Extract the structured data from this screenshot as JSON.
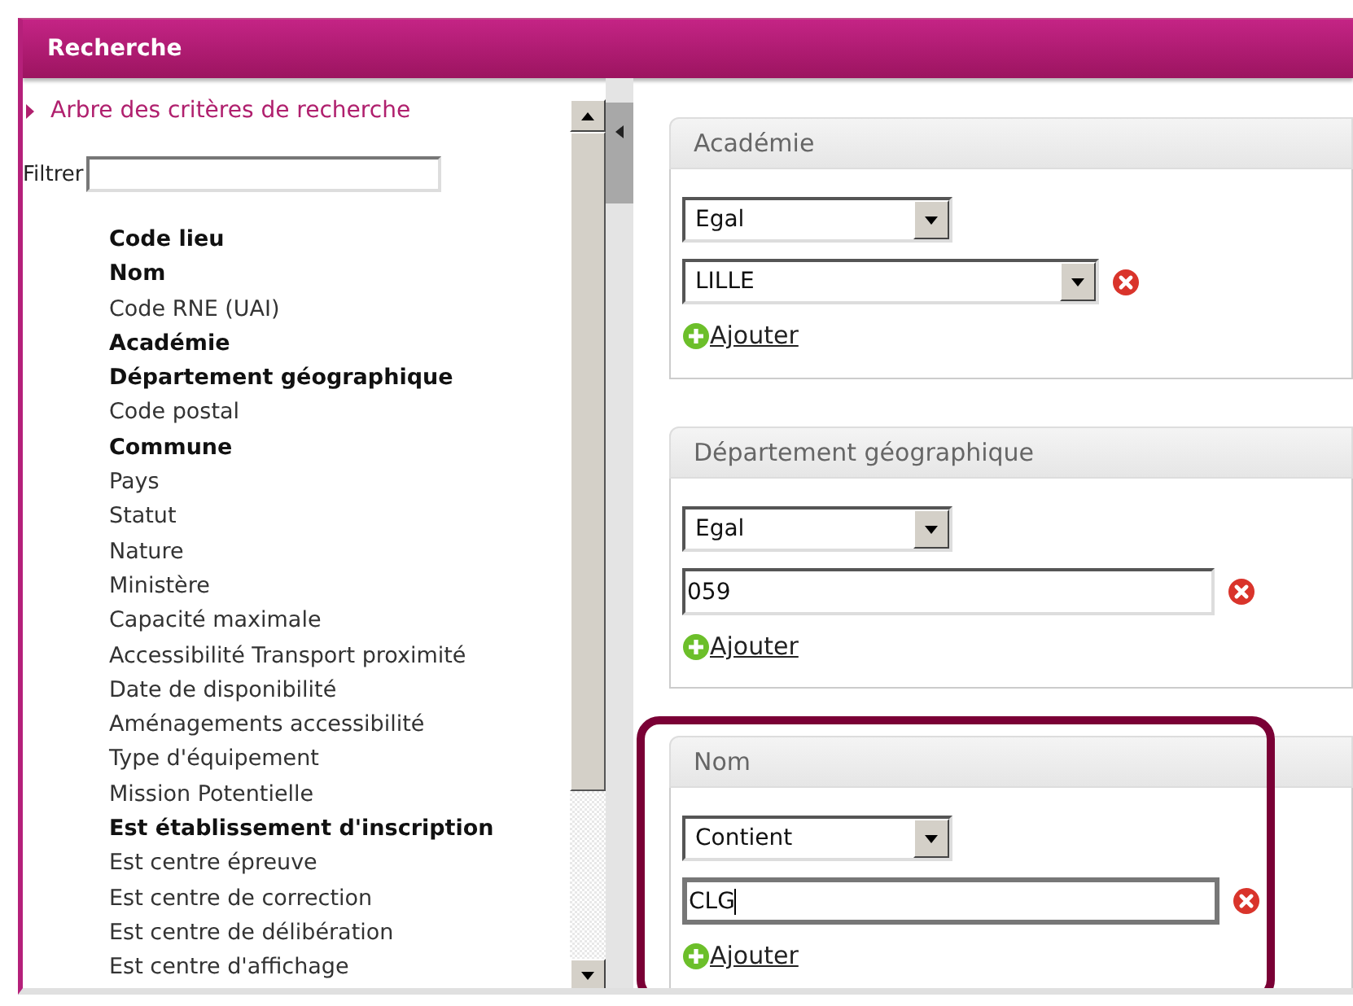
{
  "header": {
    "title": "Recherche"
  },
  "tree": {
    "title": "Arbre des critères de recherche"
  },
  "filter": {
    "label": "Filtrer"
  },
  "criteria": [
    {
      "label": "Code lieu",
      "bold": true
    },
    {
      "label": "Nom",
      "bold": true
    },
    {
      "label": "Code RNE (UAI)",
      "bold": false
    },
    {
      "label": "Académie",
      "bold": true
    },
    {
      "label": "Département géographique",
      "bold": true
    },
    {
      "label": "Code postal",
      "bold": false
    },
    {
      "label": "Commune",
      "bold": true
    },
    {
      "label": "Pays",
      "bold": false
    },
    {
      "label": "Statut",
      "bold": false
    },
    {
      "label": "Nature",
      "bold": false
    },
    {
      "label": "Ministère",
      "bold": false
    },
    {
      "label": "Capacité maximale",
      "bold": false
    },
    {
      "label": "Accessibilité Transport proximité",
      "bold": false
    },
    {
      "label": "Date de disponibilité",
      "bold": false
    },
    {
      "label": "Aménagements accessibilité",
      "bold": false
    },
    {
      "label": "Type d'équipement",
      "bold": false
    },
    {
      "label": "Mission Potentielle",
      "bold": false
    },
    {
      "label": "Est établissement d'inscription",
      "bold": true
    },
    {
      "label": "Est centre épreuve",
      "bold": false
    },
    {
      "label": "Est centre de correction",
      "bold": false
    },
    {
      "label": "Est centre de délibération",
      "bold": false
    },
    {
      "label": "Est centre d'affichage",
      "bold": false
    }
  ],
  "cards": [
    {
      "title": "Académie",
      "highlighted": false,
      "operator": "Egal",
      "value": {
        "kind": "select",
        "text": "LILLE",
        "focused": false
      },
      "add": "Ajouter"
    },
    {
      "title": "Département géographique",
      "highlighted": false,
      "operator": "Egal",
      "value": {
        "kind": "text",
        "text": "059",
        "focused": false
      },
      "add": "Ajouter"
    },
    {
      "title": "Nom",
      "highlighted": true,
      "operator": "Contient",
      "value": {
        "kind": "text",
        "text": "CLG",
        "focused": true
      },
      "add": "Ajouter"
    }
  ]
}
